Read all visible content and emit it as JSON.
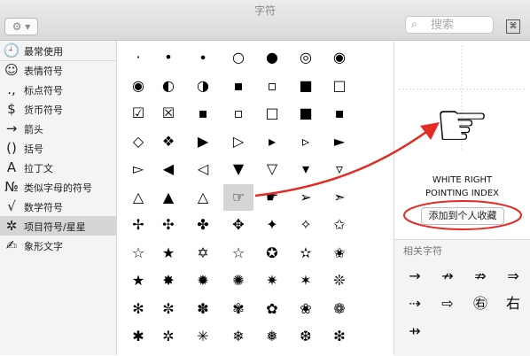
{
  "window": {
    "title": "字符"
  },
  "toolbar": {
    "gear": "⚙",
    "search_placeholder": "搜索",
    "search_icon": "magnifier",
    "grid_icon": "⌘"
  },
  "sidebar": [
    {
      "icon": "🕘",
      "label": "最常使用",
      "selected": false
    },
    {
      "icon": "☺",
      "label": "表情符号",
      "selected": false
    },
    {
      "icon": ".,",
      "label": "标点符号",
      "selected": false
    },
    {
      "icon": "$",
      "label": "货币符号",
      "selected": false
    },
    {
      "icon": "→",
      "label": "箭头",
      "selected": false
    },
    {
      "icon": "()",
      "label": "括号",
      "selected": false
    },
    {
      "icon": "A",
      "label": "拉丁文",
      "selected": false
    },
    {
      "icon": "№",
      "label": "类似字母的符号",
      "selected": false
    },
    {
      "icon": "√",
      "label": "数学符号",
      "selected": false
    },
    {
      "icon": "✲",
      "label": "项目符号/星星",
      "selected": true
    },
    {
      "icon": "✍",
      "label": "象形文字",
      "selected": false
    }
  ],
  "glyph_grid": [
    [
      "·",
      "•",
      "∙",
      "○",
      "●",
      "◎",
      "◉"
    ],
    [
      "◉",
      "◐",
      "◑",
      "▪",
      "▫",
      "■",
      "□"
    ],
    [
      "☑",
      "☒",
      "▪",
      "▫",
      "□",
      "■",
      "▪"
    ],
    [
      "◇",
      "❖",
      "▶",
      "▷",
      "▸",
      "▹",
      "►"
    ],
    [
      "▻",
      "◀",
      "◁",
      "▼",
      "▽",
      "▾",
      "▿"
    ],
    [
      "△",
      "▲",
      "△",
      "☞",
      "☛",
      "➢",
      "➣"
    ],
    [
      "✢",
      "✣",
      "✤",
      "✥",
      "✦",
      "✧",
      "✩"
    ],
    [
      "☆",
      "★",
      "✡",
      "☆",
      "✪",
      "✫",
      "✬"
    ],
    [
      "★",
      "✸",
      "✹",
      "✺",
      "✷",
      "✶",
      "❊"
    ],
    [
      "✻",
      "✼",
      "✽",
      "✾",
      "✿",
      "❀",
      "❁"
    ],
    [
      "✱",
      "✲",
      "✳",
      "❄",
      "❅",
      "❆",
      "❇"
    ]
  ],
  "selected_glyph": "☞",
  "preview": {
    "glyph": "☞",
    "name_line1": "WHITE RIGHT",
    "name_line2": "POINTING INDEX",
    "favorite_button": "添加到个人收藏"
  },
  "related": {
    "title": "相关字符",
    "items": [
      [
        "→",
        "↛",
        "⇏",
        "⇒"
      ],
      [
        "⇢",
        "⇨",
        "㊨",
        "右"
      ],
      [
        "⇸"
      ]
    ]
  },
  "annotation_color": "#e32b24"
}
